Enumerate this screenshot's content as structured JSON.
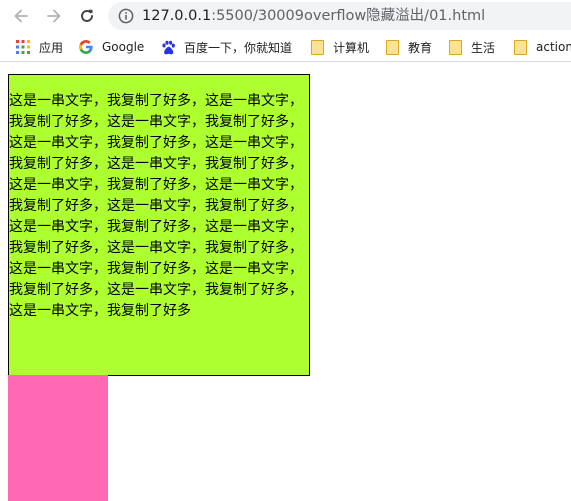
{
  "browser": {
    "url_host": "127.0.0.1",
    "url_path": ":5500/30009overflow隐藏溢出/01.html",
    "icons": {
      "back": "back-arrow-icon",
      "forward": "forward-arrow-icon",
      "reload": "reload-icon",
      "site_info": "info-icon"
    }
  },
  "bookmarks": [
    {
      "label": "应用",
      "icon": "apps-grid-icon"
    },
    {
      "label": "Google",
      "icon": "google-icon"
    },
    {
      "label": "百度一下，你就知道",
      "icon": "baidu-paw-icon"
    },
    {
      "label": "计算机",
      "icon": "folder-icon"
    },
    {
      "label": "教育",
      "icon": "folder-icon"
    },
    {
      "label": "生活",
      "icon": "folder-icon"
    },
    {
      "label": "action",
      "icon": "folder-icon"
    }
  ],
  "page": {
    "text": "这是一串文字，我复制了好多，这是一串文字，我复制了好多，这是一串文字，我复制了好多，这是一串文字，我复制了好多，这是一串文字，我复制了好多，这是一串文字，我复制了好多，这是一串文字，我复制了好多，这是一串文字，我复制了好多，这是一串文字，我复制了好多，这是一串文字，我复制了好多，这是一串文字，我复制了好多，这是一串文字，我复制了好多，这是一串文字，我复制了好多，这是一串文字，我复制了好多，这是一串文字，我复制了好多，这是一串文字，我复制了好多",
    "colors": {
      "box_background": "#adff2f",
      "box_border": "#000000",
      "pink_block": "#ff69b4"
    }
  }
}
